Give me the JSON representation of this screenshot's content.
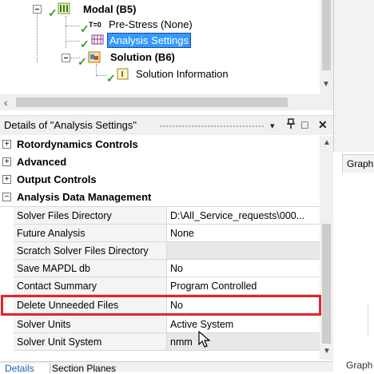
{
  "tree": {
    "items": [
      {
        "label": "Modal (B5)"
      },
      {
        "label": "Pre-Stress (None)",
        "icon_text": "T=0"
      },
      {
        "label": "Analysis Settings"
      },
      {
        "label": "Solution (B6)"
      },
      {
        "label": "Solution Information"
      }
    ]
  },
  "details": {
    "title": "Details of \"Analysis Settings\"",
    "buttons": {
      "dropdown": "▾",
      "pin": "ᵽ",
      "maximize": "□",
      "close": "✕"
    }
  },
  "grid": {
    "categories": [
      {
        "label": "Rotordynamics Controls",
        "expander": "+"
      },
      {
        "label": "Advanced",
        "expander": "+"
      },
      {
        "label": "Output Controls",
        "expander": "+"
      },
      {
        "label": "Analysis Data Management",
        "expander": "−"
      }
    ],
    "rows": [
      {
        "name": "Solver Files Directory",
        "value": "D:\\All_Service_requests\\000..."
      },
      {
        "name": "Future Analysis",
        "value": "None"
      },
      {
        "name": "Scratch Solver Files Directory",
        "value": ""
      },
      {
        "name": "Save MAPDL db",
        "value": "No"
      },
      {
        "name": "Contact Summary",
        "value": "Program Controlled"
      },
      {
        "name": "Delete Unneeded Files",
        "value": "No"
      },
      {
        "name": "Solver Units",
        "value": "Active System"
      },
      {
        "name": "Solver Unit System",
        "value": "nmm"
      }
    ]
  },
  "tabs": {
    "details": "Details",
    "section_planes": "Section Planes"
  },
  "graph": {
    "tab": "Graph",
    "tab_bottom": "Graph"
  },
  "colors": {
    "selection": "#3399ff",
    "highlight": "#e0262e",
    "check": "#2e9a2e"
  }
}
